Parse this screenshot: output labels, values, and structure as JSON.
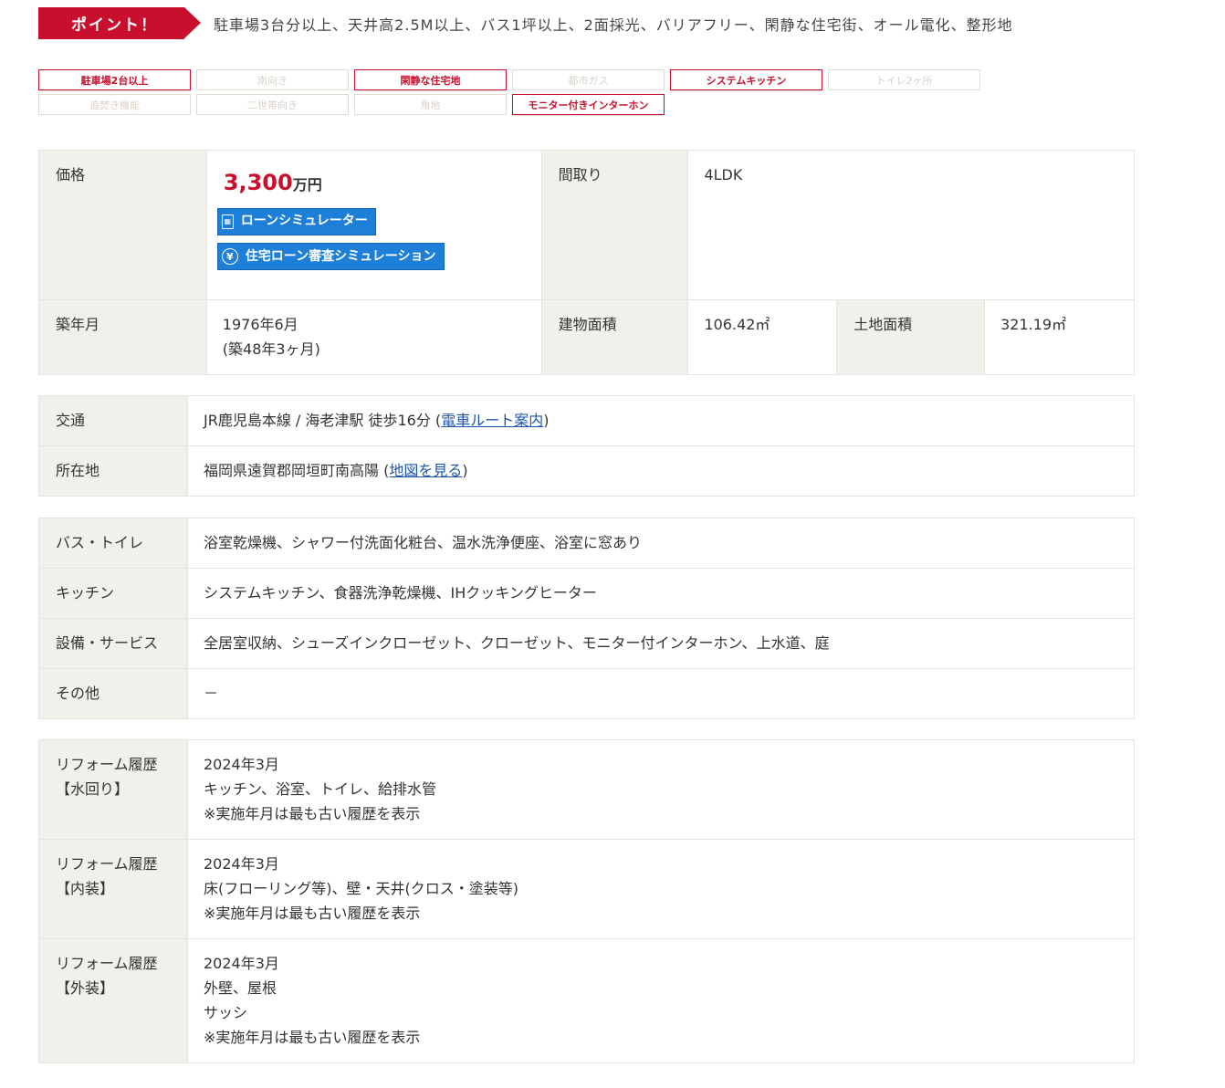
{
  "point": {
    "badge": "ポイント！",
    "text": "駐車場3台分以上、天井高2.5M以上、バス1坪以上、2面採光、バリアフリー、閑静な住宅街、オール電化、整形地"
  },
  "tags": [
    {
      "label": "駐車場2台以上",
      "active": true
    },
    {
      "label": "南向き",
      "active": false
    },
    {
      "label": "閑静な住宅地",
      "active": true
    },
    {
      "label": "都市ガス",
      "active": false
    },
    {
      "label": "システムキッチン",
      "active": true
    },
    {
      "label": "トイレ2ヶ所",
      "active": false
    },
    {
      "label": "追焚き機能",
      "active": false
    },
    {
      "label": "二世帯向き",
      "active": false
    },
    {
      "label": "角地",
      "active": false
    },
    {
      "label": "モニター付きインターホン",
      "active": true
    }
  ],
  "summary": {
    "price_label": "価格",
    "price_value": "3,300",
    "price_unit": "万円",
    "loan_button": "ローンシミュレーター",
    "loan_review_button": "住宅ローン審査シミュレーション",
    "layout_label": "間取り",
    "layout_value": "4LDK",
    "built_label": "築年月",
    "built_value": "1976年6月",
    "built_age": "(築48年3ヶ月)",
    "building_area_label": "建物面積",
    "building_area_value": "106.42㎡",
    "land_area_label": "土地面積",
    "land_area_value": "321.19㎡"
  },
  "access": {
    "transport_label": "交通",
    "transport_value": "JR鹿児島本線 / 海老津駅 徒歩16分 (",
    "transport_link": "電車ルート案内",
    "transport_close": ")",
    "address_label": "所在地",
    "address_value": "福岡県遠賀郡岡垣町南高陽 (",
    "address_link": "地図を見る",
    "address_close": ")"
  },
  "equipment": [
    {
      "label": "バス・トイレ",
      "value": "浴室乾燥機、シャワー付洗面化粧台、温水洗浄便座、浴室に窓あり"
    },
    {
      "label": "キッチン",
      "value": "システムキッチン、食器洗浄乾燥機、IHクッキングヒーター"
    },
    {
      "label": "設備・サービス",
      "value": "全居室収納、シューズインクローゼット、クローゼット、モニター付インターホン、上水道、庭"
    },
    {
      "label": "その他",
      "value": "－"
    }
  ],
  "reform": [
    {
      "label1": "リフォーム履歴",
      "label2": "【水回り】",
      "lines": [
        "2024年3月",
        "キッチン、浴室、トイレ、給排水管",
        "※実施年月は最も古い履歴を表示"
      ]
    },
    {
      "label1": "リフォーム履歴",
      "label2": "【内装】",
      "lines": [
        "2024年3月",
        "床(フローリング等)、壁・天井(クロス・塗装等)",
        "※実施年月は最も古い履歴を表示"
      ]
    },
    {
      "label1": "リフォーム履歴",
      "label2": "【外装】",
      "lines": [
        "2024年3月",
        "外壁、屋根",
        "サッシ",
        "※実施年月は最も古い履歴を表示"
      ]
    }
  ]
}
